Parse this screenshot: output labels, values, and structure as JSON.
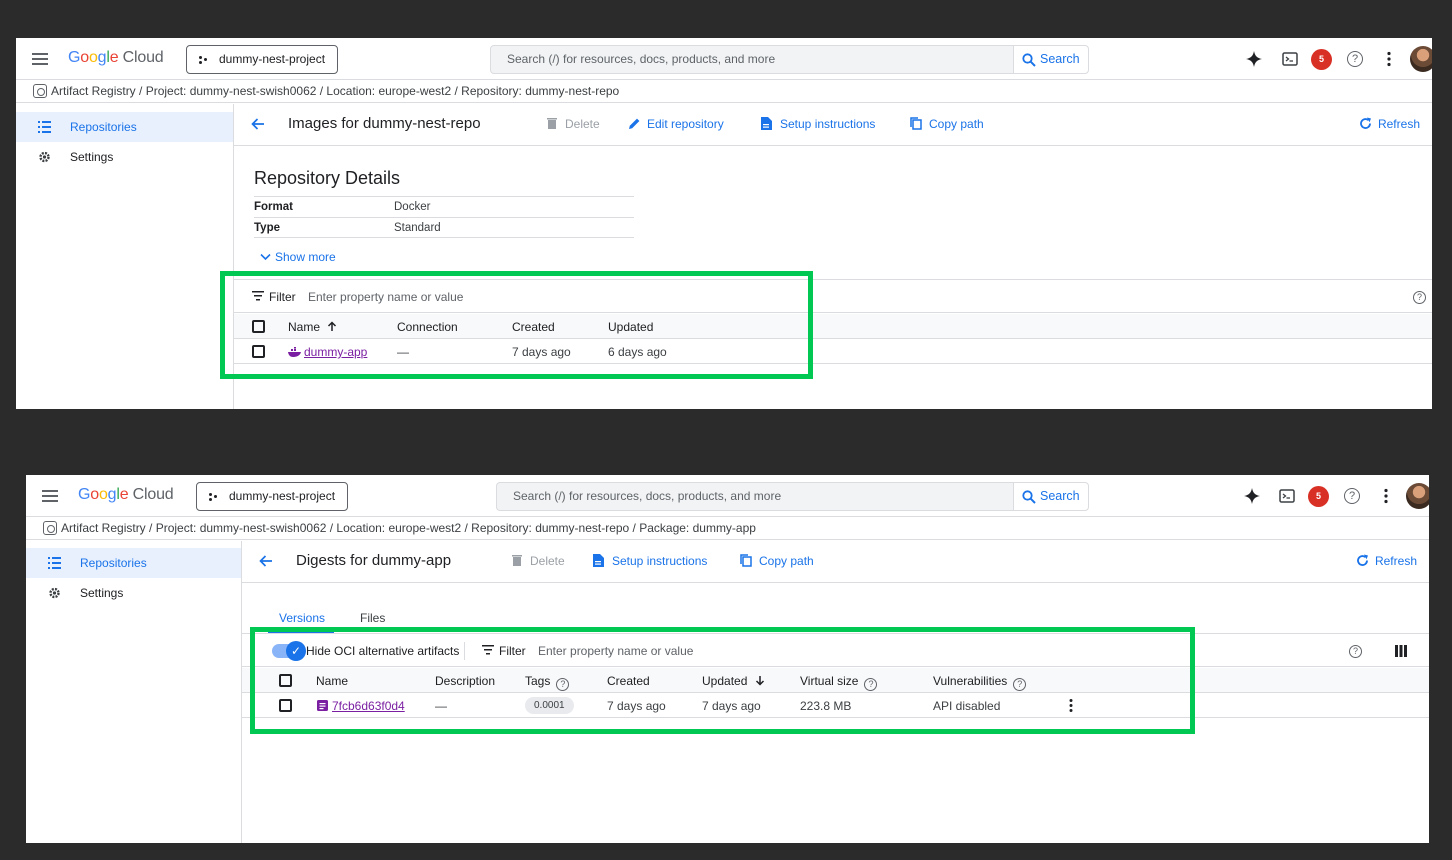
{
  "common": {
    "logo_google": "Google",
    "logo_cloud": "Cloud",
    "project": "dummy-nest-project",
    "search_placeholder": "Search (/) for resources, docs, products, and more",
    "search_button": "Search",
    "notification_count": "5",
    "sidebar": [
      {
        "label": "Repositories",
        "icon": "list-icon",
        "active": true
      },
      {
        "label": "Settings",
        "icon": "gear-icon",
        "active": false
      }
    ],
    "refresh": "Refresh",
    "delete": "Delete",
    "setup_instructions": "Setup instructions",
    "copy_path": "Copy path",
    "filter_label": "Filter",
    "filter_placeholder": "Enter property name or value",
    "accent": "#1a73e8",
    "highlight": "#00c853"
  },
  "screen1": {
    "breadcrumb": "Artifact Registry  /  Project: dummy-nest-swish0062  /  Location: europe-west2  /  Repository: dummy-nest-repo",
    "title": "Images for dummy-nest-repo",
    "edit_repository": "Edit repository",
    "details_heading": "Repository Details",
    "details": [
      {
        "key": "Format",
        "value": "Docker"
      },
      {
        "key": "Type",
        "value": "Standard"
      }
    ],
    "show_more": "Show more",
    "columns": [
      "Name",
      "Connection",
      "Created",
      "Updated"
    ],
    "rows": [
      {
        "name": "dummy-app",
        "connection": "—",
        "created": "7 days ago",
        "updated": "6 days ago"
      }
    ]
  },
  "screen2": {
    "breadcrumb": "Artifact Registry  /  Project: dummy-nest-swish0062  /  Location: europe-west2  /  Repository: dummy-nest-repo  /  Package: dummy-app",
    "title": "Digests for dummy-app",
    "tabs": [
      "Versions",
      "Files"
    ],
    "hide_oci": "Hide OCI alternative artifacts",
    "hide_oci_on": true,
    "columns": [
      "Name",
      "Description",
      "Tags",
      "Created",
      "Updated",
      "Virtual size",
      "Vulnerabilities"
    ],
    "rows": [
      {
        "name": "7fcb6d63f0d4",
        "description": "—",
        "tag": "0.0001",
        "created": "7 days ago",
        "updated": "7 days ago",
        "size": "223.8 MB",
        "vulnerabilities": "API disabled"
      }
    ]
  }
}
